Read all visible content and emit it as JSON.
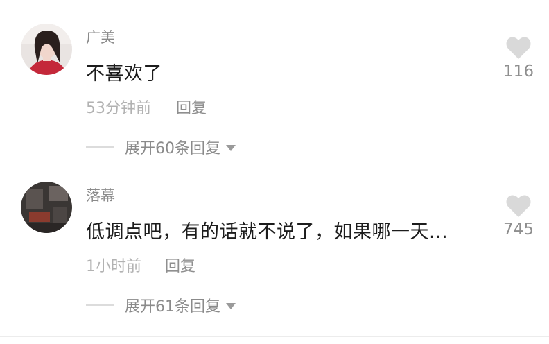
{
  "comments": [
    {
      "username": "广美",
      "text": "不喜欢了",
      "time": "53分钟前",
      "reply_label": "回复",
      "expand_label": "展开60条回复",
      "likes": "116"
    },
    {
      "username": "落幕",
      "text": "低调点吧，有的话就不说了，如果哪一天...",
      "time": "1小时前",
      "reply_label": "回复",
      "expand_label": "展开61条回复",
      "likes": "745"
    }
  ],
  "colors": {
    "text_primary": "#1c1c1c",
    "text_secondary": "#8a8a8a",
    "text_muted": "#b2b2b2",
    "like_icon": "#d9d9d9"
  },
  "icons": {
    "like": "heart-icon",
    "expand": "caret-down-icon"
  }
}
